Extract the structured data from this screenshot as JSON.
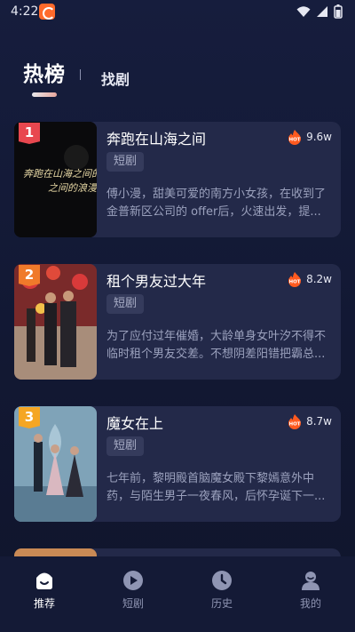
{
  "status_bar": {
    "time": "4:22"
  },
  "header": {
    "tab_hot": "热榜",
    "tab_find": "找剧"
  },
  "list": [
    {
      "rank": "1",
      "title": "奔跑在山海之间",
      "heat": "9.6w",
      "tag": "短剧",
      "desc": "傅小漫，甜美可爱的南方小女孩，在收到了金普新区公司的 offer后，火速出发，提...",
      "cover_text": "奔跑在山海之间的浪漫",
      "rank_color": "#e8474f"
    },
    {
      "rank": "2",
      "title": "租个男友过大年",
      "heat": "8.2w",
      "tag": "短剧",
      "desc": "为了应付过年催婚，大龄单身女叶汐不得不临时租个男友交差。不想阴差阳错把霸总...",
      "rank_color": "#f07a2a"
    },
    {
      "rank": "3",
      "title": "魔女在上",
      "heat": "8.7w",
      "tag": "短剧",
      "desc": "七年前，黎明殿首脑魔女殿下黎嫣意外中药，与陌生男子一夜春风，后怀孕诞下一...",
      "rank_color": "#f5a623"
    }
  ],
  "hot_badge": "HOT",
  "bottom_nav": [
    {
      "label": "推荐",
      "icon": "home-icon"
    },
    {
      "label": "短剧",
      "icon": "play-icon"
    },
    {
      "label": "历史",
      "icon": "clock-icon"
    },
    {
      "label": "我的",
      "icon": "profile-icon"
    }
  ],
  "colors": {
    "background": "#131a36",
    "card": "#232949",
    "hot": "#ff5a1f"
  }
}
